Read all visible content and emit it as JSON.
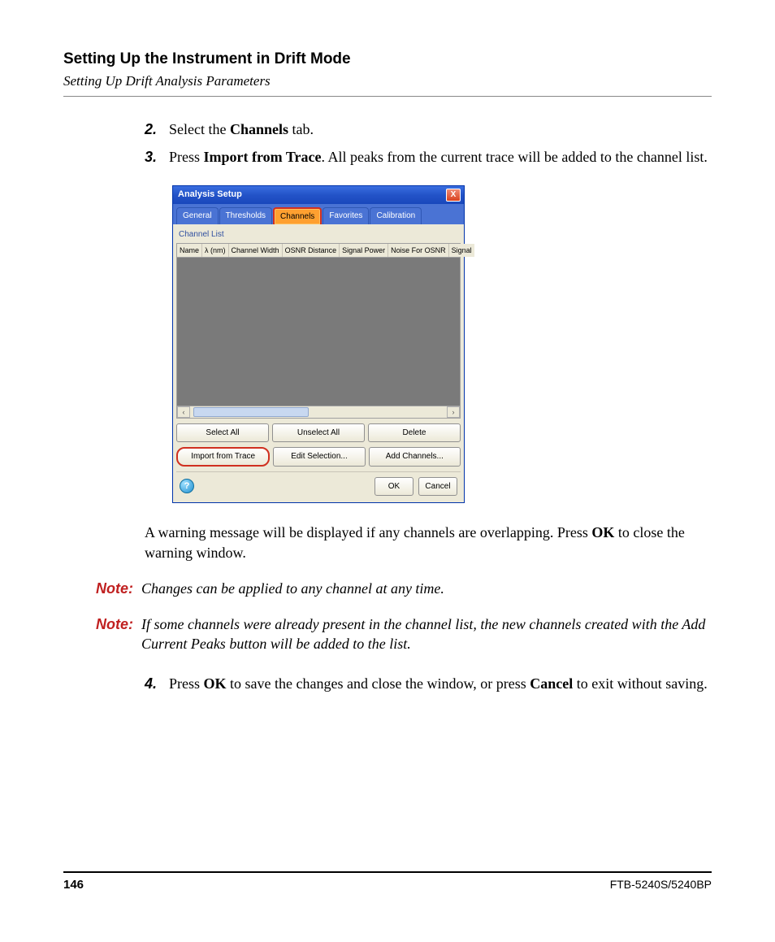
{
  "header": {
    "title": "Setting Up the Instrument in Drift Mode",
    "subtitle": "Setting Up Drift Analysis Parameters"
  },
  "steps": {
    "s2": {
      "num": "2.",
      "pre": "Select the ",
      "bold": "Channels",
      "post": " tab."
    },
    "s3": {
      "num": "3.",
      "pre": "Press ",
      "bold": "Import from Trace",
      "post": ". All peaks from the current trace will be added to the channel list."
    },
    "s4": {
      "num": "4.",
      "pre": "Press ",
      "bold1": "OK",
      "mid": " to save the changes and close the window, or press ",
      "bold2": "Cancel",
      "post": " to exit without saving."
    }
  },
  "warning_para": {
    "pre": "A warning message will be displayed if any channels are overlapping. Press ",
    "bold": "OK",
    "post": " to close the warning window."
  },
  "notes": {
    "label": "Note:",
    "n1": "Changes can be applied to any channel at any time.",
    "n2": "If some channels were already present in the channel list, the new channels created with the Add Current Peaks button will be added to the list."
  },
  "dialog": {
    "title": "Analysis Setup",
    "close_x": "X",
    "tabs": [
      "General",
      "Thresholds",
      "Channels",
      "Favorites",
      "Calibration"
    ],
    "group": "Channel List",
    "columns": [
      "Name",
      "λ (nm)",
      "Channel Width",
      "OSNR Distance",
      "Signal Power",
      "Noise For OSNR",
      "Signal"
    ],
    "row1": {
      "select_all": "Select All",
      "unselect_all": "Unselect All",
      "delete": "Delete"
    },
    "row2": {
      "import": "Import from Trace",
      "edit": "Edit Selection...",
      "add": "Add Channels..."
    },
    "help": "?",
    "ok": "OK",
    "cancel": "Cancel",
    "scroll_left": "‹",
    "scroll_right": "›"
  },
  "footer": {
    "page": "146",
    "docid": "FTB-5240S/5240BP"
  }
}
